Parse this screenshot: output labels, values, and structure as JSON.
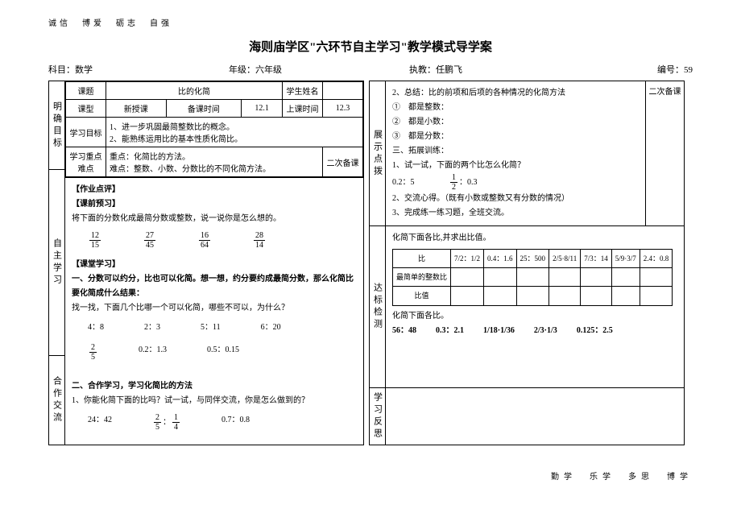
{
  "motto_top": "诚信　博爱　砺志　自强",
  "title": "海则庙学区\"六环节自主学习\"教学模式导学案",
  "meta": {
    "subject_label": "科目：",
    "subject": "数学",
    "grade_label": "年级：",
    "grade": "六年级",
    "teacher_label": "执教：",
    "teacher": "任鹏飞",
    "number_label": "编号：",
    "number": "59"
  },
  "left": {
    "tab1": "明确目标",
    "tab2": "自主学习",
    "tab3": "合作交流",
    "head": {
      "topic_label": "课题",
      "topic": "比的化简",
      "student_label": "学生姓名",
      "type_label": "课型",
      "type": "新授课",
      "preptime_label": "备课时间",
      "preptime": "12.1",
      "classtime_label": "上课时间",
      "classtime": "12.3",
      "goal_label": "学习目标",
      "goal": "1、进一步巩固最简整数比的概念。\n2、能熟练运用比的基本性质化简比。",
      "focus_label": "学习重点难点",
      "focus": "重点：化简比的方法。\n难点：整数、小数、分数比的不同化简方法。",
      "note_label": "二次备课"
    },
    "body": {
      "hw": "【作业点评】",
      "pre": "【课前预习】",
      "pre_text": "将下面的分数化成最简分数或整数，说一说你是怎么想的。",
      "fracs": [
        {
          "n": "12",
          "d": "15"
        },
        {
          "n": "27",
          "d": "45"
        },
        {
          "n": "16",
          "d": "64"
        },
        {
          "n": "28",
          "d": "14"
        }
      ],
      "cls": "【课堂学习】",
      "s1_title": "一、分数可以约分，比也可以化简。想一想，约分要约成最简分数，那么化简比要化简成什么结果：",
      "s1_text": "找一找，下面几个比哪一个可以化简，哪些不可以，为什么？",
      "ratios1": [
        "4：8",
        "2：3",
        "5：11",
        "6：20"
      ],
      "ratios2_a": {
        "n": "2",
        "d": "5"
      },
      "ratios2_b": "0.2：1.3",
      "ratios2_c": "0.5：0.15",
      "s2_title": "二、合作学习，学习化简比的方法",
      "s2_text": "1、你能化简下面的比吗？试一试，与同伴交流，你是怎么做到的？",
      "ratios3_a": "24：42",
      "ratios3_b_n1": "2",
      "ratios3_b_d1": "5",
      "ratios3_b_n2": "1",
      "ratios3_b_d2": "4",
      "ratios3_c": "0.7：0.8"
    }
  },
  "right": {
    "block1_tab": "展示点拨",
    "block1_note": "二次备课",
    "block1": {
      "l1": "2、总结：比的前项和后项的各种情况的化简方法",
      "l2": "①　都是整数：",
      "l3": "②　都是小数：",
      "l4": "③　都是分数：",
      "l5": "三、拓展训练：",
      "l6": "1、试一试，下面的两个比怎么化简？",
      "l7a": "0.2：5",
      "l7b_n": "1",
      "l7b_d": "2",
      "l7b_t": "：0.3",
      "l8": "2、交流心得。（既有小数或整数又有分数的情况）",
      "l9": "3、完成练一练习题，全班交流。"
    },
    "block2_tab": "达标检测",
    "block2": {
      "title": "化简下面各比,并求出比值。",
      "head_r": "比",
      "head_c": [
        "7/2：1/2",
        "0.4：1.6",
        "25：500",
        "2/5·8/11",
        "7/3：14",
        "5/9·3/7",
        "2.4：0.8"
      ],
      "row1": "最简单的整数比",
      "row2": "比值",
      "title2": "化简下面各比。",
      "items": [
        "56：48",
        "0.3：2.1",
        "1/18·1/36",
        "2/3·1/3",
        "0.125：2.5"
      ]
    },
    "block3_tab": "学习反思"
  },
  "motto_bottom": "勤学　乐学　多思　博学"
}
